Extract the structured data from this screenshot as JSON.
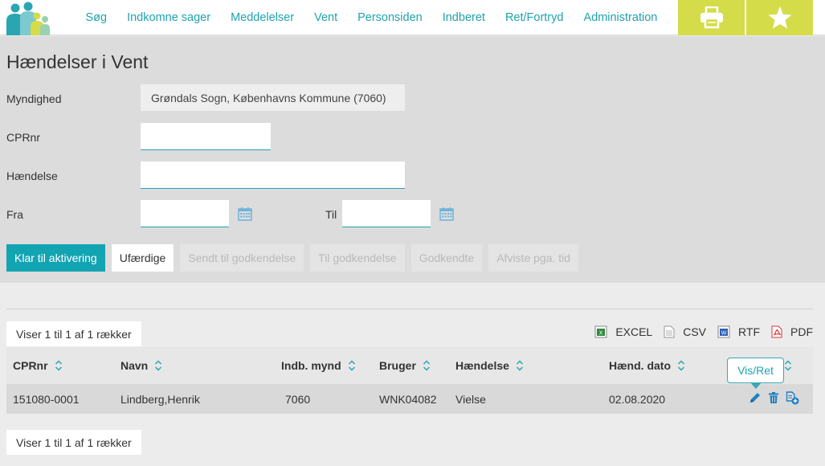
{
  "nav": {
    "items": [
      "Søg",
      "Indkomne sager",
      "Meddelelser",
      "Vent",
      "Personsiden",
      "Indberet",
      "Ret/Fortryd",
      "Administration"
    ],
    "print_icon": "printer-icon",
    "favorite_icon": "star-icon"
  },
  "page": {
    "title": "Hændelser i Vent"
  },
  "form": {
    "myndighed_label": "Myndighed",
    "myndighed_value": "Grøndals Sogn, Københavns Kommune (7060)",
    "cprnr_label": "CPRnr",
    "cprnr_value": "",
    "haendelse_label": "Hændelse",
    "haendelse_value": "",
    "fra_label": "Fra",
    "fra_value": "",
    "til_label": "Til",
    "til_value": "",
    "calendar_icon": "calendar-icon"
  },
  "tabs": [
    "Klar til aktivering",
    "Ufærdige",
    "Sendt til godkendelse",
    "Til godkendelse",
    "Godkendte",
    "Afviste pga. tid"
  ],
  "results": {
    "count_top": "Viser 1 til 1 af 1 rækker",
    "count_bottom": "Viser 1 til 1 af 1 rækker",
    "exports": [
      "EXCEL",
      "CSV",
      "RTF",
      "PDF"
    ],
    "columns": [
      "CPRnr",
      "Navn",
      "Indb. mynd",
      "Bruger",
      "Hænd. dato"
    ],
    "haendelse_column": "Hændelse",
    "rows": [
      {
        "cprnr": "151080-0001",
        "navn": "Lindberg,Henrik",
        "indb_mynd": "7060",
        "bruger": "WNK04082",
        "haendelse": "Vielse",
        "dato": "02.08.2020"
      }
    ],
    "tooltip": "Vis/Ret"
  },
  "colors": {
    "accent": "#12a4b2",
    "nav_link": "#1fa3ad",
    "toolbar": "#d5dc4a"
  }
}
